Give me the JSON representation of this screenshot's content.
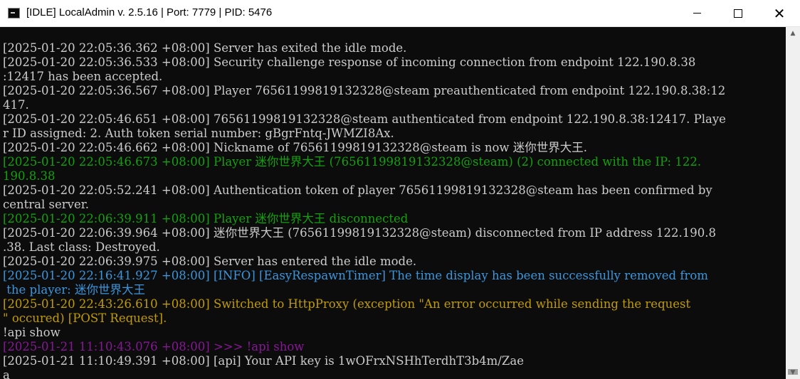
{
  "window": {
    "title": "[IDLE] LocalAdmin v. 2.5.16 | Port: 7779 | PID: 5476",
    "minimize_icon": "minimize-icon",
    "maximize_icon": "maximize-icon",
    "close_icon": "close-icon"
  },
  "colors": {
    "default": "#cccccc",
    "green": "#13a10e",
    "cyan": "#3a96dd",
    "yellow": "#c19c00",
    "magenta": "#881798",
    "background": "#0c0c0c"
  },
  "console": {
    "lines": [
      {
        "text": "[2025-01-20 22:05:36.362 +08:00] Server has exited the idle mode.",
        "color": "#cccccc"
      },
      {
        "text": "[2025-01-20 22:05:36.533 +08:00] Security challenge response of incoming connection from endpoint 122.190.8.38",
        "color": "#cccccc"
      },
      {
        "text": ":12417 has been accepted.",
        "color": "#cccccc"
      },
      {
        "text": "[2025-01-20 22:05:36.567 +08:00] Player 76561199819132328@steam preauthenticated from endpoint 122.190.8.38:12",
        "color": "#cccccc"
      },
      {
        "text": "417.",
        "color": "#cccccc"
      },
      {
        "text": "[2025-01-20 22:05:46.651 +08:00] 76561199819132328@steam authenticated from endpoint 122.190.8.38:12417. Playe",
        "color": "#cccccc"
      },
      {
        "text": "r ID assigned: 2. Auth token serial number: gBgrFntq-JWMZI8Ax.",
        "color": "#cccccc"
      },
      {
        "text": "[2025-01-20 22:05:46.662 +08:00] Nickname of 76561199819132328@steam is now 迷你世界大王.",
        "color": "#cccccc"
      },
      {
        "text": "[2025-01-20 22:05:46.673 +08:00] Player 迷你世界大王 (76561199819132328@steam) (2) connected with the IP: 122.",
        "color": "#13a10e"
      },
      {
        "text": "190.8.38",
        "color": "#13a10e"
      },
      {
        "text": "[2025-01-20 22:05:52.241 +08:00] Authentication token of player 76561199819132328@steam has been confirmed by",
        "color": "#cccccc"
      },
      {
        "text": "central server.",
        "color": "#cccccc"
      },
      {
        "text": "[2025-01-20 22:06:39.911 +08:00] Player 迷你世界大王 disconnected",
        "color": "#13a10e"
      },
      {
        "text": "[2025-01-20 22:06:39.964 +08:00] 迷你世界大王 (76561199819132328@steam) disconnected from IP address 122.190.8",
        "color": "#cccccc"
      },
      {
        "text": ".38. Last class: Destroyed.",
        "color": "#cccccc"
      },
      {
        "text": "[2025-01-20 22:06:39.975 +08:00] Server has entered the idle mode.",
        "color": "#cccccc"
      },
      {
        "text": "[2025-01-20 22:16:41.927 +08:00] [INFO] [EasyRespawnTimer] The time display has been successfully removed from",
        "color": "#3a96dd"
      },
      {
        "text": " the player: 迷你世界大王",
        "color": "#3a96dd"
      },
      {
        "text": "[2025-01-20 22:43:26.610 +08:00] Switched to HttpProxy (exception \"An error occurred while sending the request",
        "color": "#c19c00"
      },
      {
        "text": "\" occured) [POST Request].",
        "color": "#c19c00"
      },
      {
        "text": "!api show",
        "color": "#cccccc"
      },
      {
        "text": "[2025-01-21 11:10:43.076 +08:00] >>> !api show",
        "color": "#881798"
      },
      {
        "text": "[2025-01-21 11:10:49.391 +08:00] [api] Your API key is 1wOFrxNSHhTerdhT3b4m/Zae",
        "color": "#cccccc"
      },
      {
        "text": "a",
        "color": "#cccccc"
      }
    ]
  },
  "scrollbar": {
    "up_icon": "scroll-up-arrow-icon",
    "down_icon": "scroll-down-arrow-icon",
    "position": 1.0
  }
}
